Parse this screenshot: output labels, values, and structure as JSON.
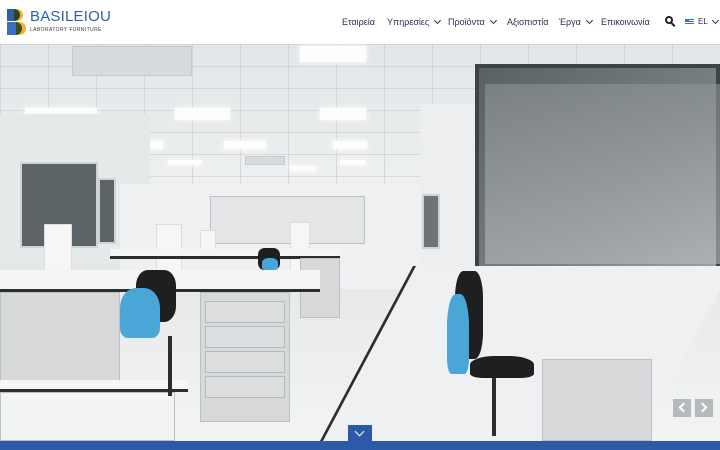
{
  "brand": {
    "name": "BASILEIOU",
    "tagline": "LABORATORY FURNITURE",
    "colors": {
      "blue": "#2f5fa8",
      "yellow": "#f2b52b",
      "nav_text": "#2d2d5a",
      "bar": "#2c5aa8"
    }
  },
  "nav": {
    "items": [
      {
        "label": "Εταιρεία",
        "has_dropdown": false
      },
      {
        "label": "Υπηρεσίες",
        "has_dropdown": true
      },
      {
        "label": "Προϊόντα",
        "has_dropdown": true
      },
      {
        "label": "Αξιοπιστία",
        "has_dropdown": false
      },
      {
        "label": "Έργα",
        "has_dropdown": true
      },
      {
        "label": "Επικοινωνία",
        "has_dropdown": false
      }
    ],
    "search_icon": "search-icon",
    "language": {
      "code": "EL",
      "flag_icon": "greek-flag-icon"
    }
  },
  "hero": {
    "image_subject": "laboratory-interior-photo",
    "prev_icon": "chevron-left-icon",
    "next_icon": "chevron-right-icon",
    "scroll_icon": "chevron-down-icon"
  }
}
